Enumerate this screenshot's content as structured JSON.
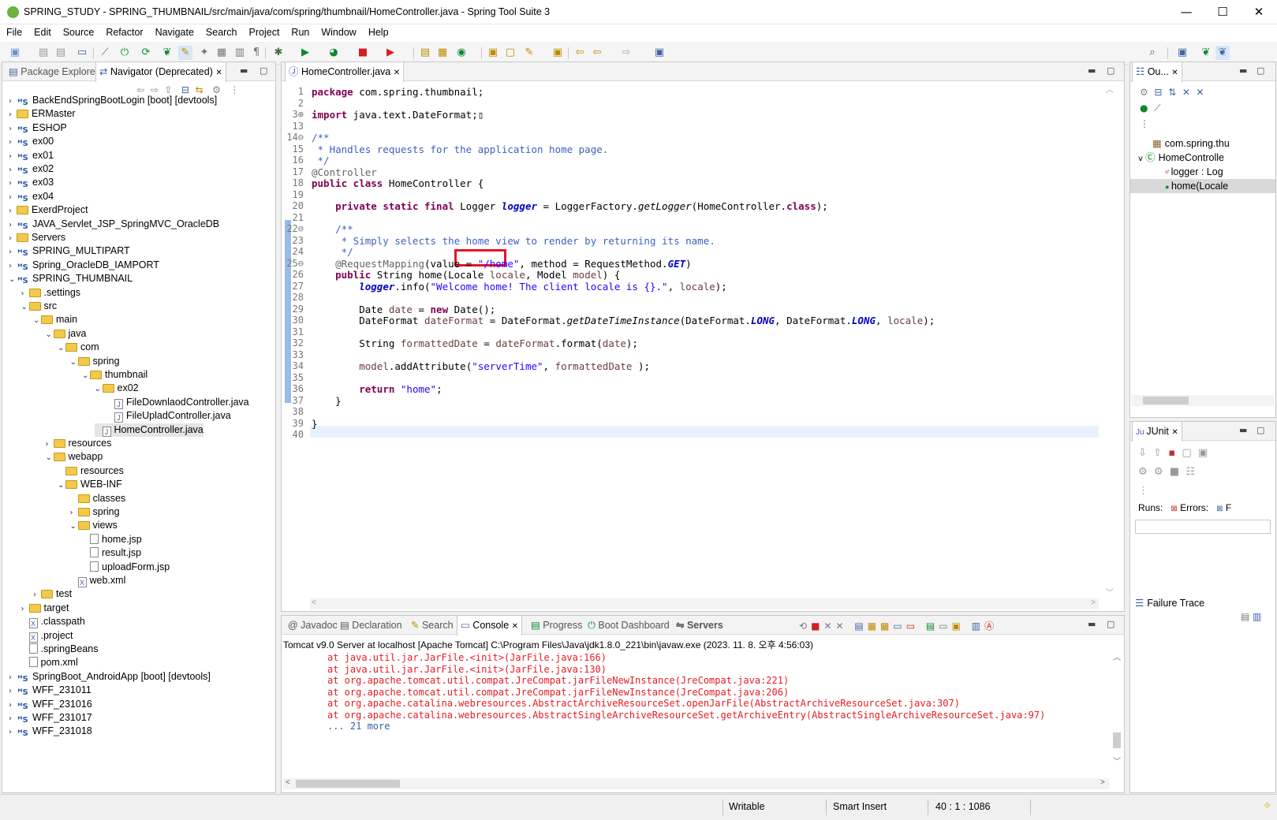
{
  "window": {
    "title": "SPRING_STUDY - SPRING_THUMBNAIL/src/main/java/com/spring/thumbnail/HomeController.java - Spring Tool Suite 3",
    "minimize": "—",
    "maximize": "☐",
    "close": "✕"
  },
  "menu": [
    "File",
    "Edit",
    "Source",
    "Refactor",
    "Navigate",
    "Search",
    "Project",
    "Run",
    "Window",
    "Help"
  ],
  "left_panel": {
    "tab1": "Package Explorer",
    "tab2": "Navigator (Deprecated)",
    "tree": [
      {
        "label": "BackEndSpringBootLogin [boot] [devtools]",
        "depth": 0,
        "icon": "project",
        "tw": ">"
      },
      {
        "label": "ERMaster",
        "depth": 0,
        "icon": "folder",
        "tw": ">"
      },
      {
        "label": "ESHOP",
        "depth": 0,
        "icon": "project",
        "tw": ">"
      },
      {
        "label": "ex00",
        "depth": 0,
        "icon": "project",
        "tw": ">"
      },
      {
        "label": "ex01",
        "depth": 0,
        "icon": "project",
        "tw": ">"
      },
      {
        "label": "ex02",
        "depth": 0,
        "icon": "project",
        "tw": ">"
      },
      {
        "label": "ex03",
        "depth": 0,
        "icon": "project",
        "tw": ">"
      },
      {
        "label": "ex04",
        "depth": 0,
        "icon": "project",
        "tw": ">"
      },
      {
        "label": "ExerdProject",
        "depth": 0,
        "icon": "folder",
        "tw": ">"
      },
      {
        "label": "JAVA_Servlet_JSP_SpringMVC_OracleDB",
        "depth": 0,
        "icon": "project",
        "tw": ">"
      },
      {
        "label": "Servers",
        "depth": 0,
        "icon": "folder",
        "tw": ">"
      },
      {
        "label": "SPRING_MULTIPART",
        "depth": 0,
        "icon": "project",
        "tw": ">"
      },
      {
        "label": "Spring_OracleDB_IAMPORT",
        "depth": 0,
        "icon": "project",
        "tw": ">"
      },
      {
        "label": "SPRING_THUMBNAIL",
        "depth": 0,
        "icon": "project",
        "tw": "v"
      },
      {
        "label": ".settings",
        "depth": 1,
        "icon": "folder",
        "tw": ">"
      },
      {
        "label": "src",
        "depth": 1,
        "icon": "folder",
        "tw": "v"
      },
      {
        "label": "main",
        "depth": 2,
        "icon": "folder",
        "tw": "v"
      },
      {
        "label": "java",
        "depth": 3,
        "icon": "folder",
        "tw": "v"
      },
      {
        "label": "com",
        "depth": 4,
        "icon": "folder",
        "tw": "v"
      },
      {
        "label": "spring",
        "depth": 5,
        "icon": "folder",
        "tw": "v"
      },
      {
        "label": "thumbnail",
        "depth": 6,
        "icon": "folder",
        "tw": "v"
      },
      {
        "label": "ex02",
        "depth": 7,
        "icon": "folder",
        "tw": "v"
      },
      {
        "label": "FileDownlaodController.java",
        "depth": 8,
        "icon": "java",
        "tw": ""
      },
      {
        "label": "FileUpladController.java",
        "depth": 8,
        "icon": "java",
        "tw": ""
      },
      {
        "label": "HomeController.java",
        "depth": 7,
        "icon": "java",
        "tw": "",
        "selected": true
      },
      {
        "label": "resources",
        "depth": 3,
        "icon": "folder",
        "tw": ">"
      },
      {
        "label": "webapp",
        "depth": 3,
        "icon": "folder",
        "tw": "v"
      },
      {
        "label": "resources",
        "depth": 4,
        "icon": "folder",
        "tw": ""
      },
      {
        "label": "WEB-INF",
        "depth": 4,
        "icon": "folder",
        "tw": "v"
      },
      {
        "label": "classes",
        "depth": 5,
        "icon": "folder",
        "tw": ""
      },
      {
        "label": "spring",
        "depth": 5,
        "icon": "folder",
        "tw": ">"
      },
      {
        "label": "views",
        "depth": 5,
        "icon": "folder",
        "tw": "v"
      },
      {
        "label": "home.jsp",
        "depth": 6,
        "icon": "file",
        "tw": ""
      },
      {
        "label": "result.jsp",
        "depth": 6,
        "icon": "file",
        "tw": ""
      },
      {
        "label": "uploadForm.jsp",
        "depth": 6,
        "icon": "file",
        "tw": ""
      },
      {
        "label": "web.xml",
        "depth": 5,
        "icon": "xml",
        "tw": ""
      },
      {
        "label": "test",
        "depth": 2,
        "icon": "folder",
        "tw": ">"
      },
      {
        "label": "target",
        "depth": 1,
        "icon": "folder",
        "tw": ">"
      },
      {
        "label": ".classpath",
        "depth": 1,
        "icon": "xml",
        "tw": ""
      },
      {
        "label": ".project",
        "depth": 1,
        "icon": "xml",
        "tw": ""
      },
      {
        "label": ".springBeans",
        "depth": 1,
        "icon": "file",
        "tw": ""
      },
      {
        "label": "pom.xml",
        "depth": 1,
        "icon": "file",
        "tw": ""
      },
      {
        "label": "SpringBoot_AndroidApp [boot] [devtools]",
        "depth": 0,
        "icon": "project",
        "tw": ">"
      },
      {
        "label": "WFF_231011",
        "depth": 0,
        "icon": "project",
        "tw": ">"
      },
      {
        "label": "WFF_231016",
        "depth": 0,
        "icon": "project",
        "tw": ">"
      },
      {
        "label": "WFF_231017",
        "depth": 0,
        "icon": "project",
        "tw": ">"
      },
      {
        "label": "WFF_231018",
        "depth": 0,
        "icon": "project",
        "tw": ">"
      }
    ]
  },
  "editor": {
    "tab": "HomeController.java",
    "lines": [
      {
        "n": "1",
        "html": "<span class='kw'>package</span> com.spring.thumbnail;"
      },
      {
        "n": "2",
        "html": ""
      },
      {
        "n": "3⊕",
        "html": "<span class='kw'>import</span> java.text.DateFormat;▯"
      },
      {
        "n": "13",
        "html": ""
      },
      {
        "n": "14⊖",
        "html": "<span class='cm'>/**</span>"
      },
      {
        "n": "15",
        "html": "<span class='cm'> * Handles requests for the application home page.</span>"
      },
      {
        "n": "16",
        "html": "<span class='cm'> */</span>"
      },
      {
        "n": "17",
        "html": "<span class='an'>@Controller</span>"
      },
      {
        "n": "18",
        "html": "<span class='kw'>public class</span> HomeController {"
      },
      {
        "n": "19",
        "html": ""
      },
      {
        "n": "20",
        "html": "    <span class='kw'>private static final</span> Logger <span class='fs'>logger</span> = LoggerFactory.<span class='mi'>getLogger</span>(HomeController.<span class='kw'>class</span>);"
      },
      {
        "n": "21",
        "html": ""
      },
      {
        "n": "22⊖",
        "html": "    <span class='cm'>/**</span>"
      },
      {
        "n": "23",
        "html": "<span class='cm'>     * Simply selects the home view to render by returning its name.</span>"
      },
      {
        "n": "24",
        "html": "<span class='cm'>     */</span>"
      },
      {
        "n": "25⊖",
        "html": "    <span class='an'>@RequestMapping</span>(value = <span class='st'>\"/home\"</span>, method = RequestMethod.<span class='fs'>GET</span>)"
      },
      {
        "n": "26",
        "html": "    <span class='kw'>public</span> String home(Locale <span class='vr'>locale</span>, Model <span class='vr'>model</span>) {"
      },
      {
        "n": "27",
        "html": "        <span class='fs'>logger</span>.info(<span class='st'>\"Welcome home! The client locale is {}.\"</span>, <span class='vr'>locale</span>);"
      },
      {
        "n": "28",
        "html": ""
      },
      {
        "n": "29",
        "html": "        Date <span class='vr'>date</span> = <span class='kw'>new</span> Date();"
      },
      {
        "n": "30",
        "html": "        DateFormat <span class='vr'>dateFormat</span> = DateFormat.<span class='mi'>getDateTimeInstance</span>(DateFormat.<span class='fs'>LONG</span>, DateFormat.<span class='fs'>LONG</span>, <span class='vr'>locale</span>);"
      },
      {
        "n": "31",
        "html": ""
      },
      {
        "n": "32",
        "html": "        String <span class='vr'>formattedDate</span> = <span class='vr'>dateFormat</span>.format(<span class='vr'>date</span>);"
      },
      {
        "n": "33",
        "html": ""
      },
      {
        "n": "34",
        "html": "        <span class='vr'>model</span>.addAttribute(<span class='st'>\"serverTime\"</span>, <span class='vr'>formattedDate</span> );"
      },
      {
        "n": "35",
        "html": ""
      },
      {
        "n": "36",
        "html": "        <span class='kw'>return</span> <span class='st'>\"home\"</span>;"
      },
      {
        "n": "37",
        "html": "    }"
      },
      {
        "n": "38",
        "html": ""
      },
      {
        "n": "39",
        "html": "}"
      },
      {
        "n": "40",
        "html": ""
      }
    ]
  },
  "outline": {
    "tab": "Ou...",
    "items": [
      "com.spring.thu",
      "HomeControlle",
      "logger : Log",
      "home(Locale"
    ]
  },
  "junit": {
    "tab": "JUnit",
    "runs_label": "Runs:",
    "errors_label": "Errors:",
    "failures_label": "F",
    "failure_trace": "Failure Trace"
  },
  "bottom_tabs": [
    "Javadoc",
    "Declaration",
    "Search",
    "Console",
    "Progress",
    "Boot Dashboard",
    "Servers"
  ],
  "console": {
    "header": "Tomcat v9.0 Server at localhost [Apache Tomcat] C:\\Program Files\\Java\\jdk1.8.0_221\\bin\\javaw.exe  (2023. 11. 8. 오후 4:56:03)",
    "lines": [
      "at java.util.jar.JarFile.<init>(JarFile.java:166)",
      "at java.util.jar.JarFile.<init>(JarFile.java:130)",
      "at org.apache.tomcat.util.compat.JreCompat.jarFileNewInstance(JreCompat.java:221)",
      "at org.apache.tomcat.util.compat.JreCompat.jarFileNewInstance(JreCompat.java:206)",
      "at org.apache.catalina.webresources.AbstractArchiveResourceSet.openJarFile(AbstractArchiveResourceSet.java:307)",
      "at org.apache.catalina.webresources.AbstractSingleArchiveResourceSet.getArchiveEntry(AbstractSingleArchiveResourceSet.java:97)",
      "... 21 more"
    ]
  },
  "status": {
    "writable": "Writable",
    "insert_mode": "Smart Insert",
    "position": "40 : 1 : 1086"
  },
  "colors": {
    "highlight_box": "#e81123",
    "console_error": "#e51c23",
    "accent": "#3c62a8"
  }
}
